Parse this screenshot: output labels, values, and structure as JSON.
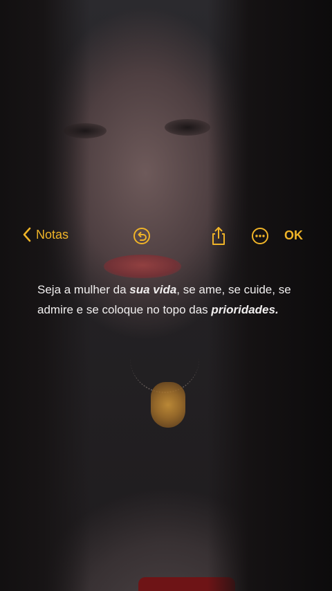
{
  "colors": {
    "accent": "#f0b428",
    "text": "#f1efef"
  },
  "navbar": {
    "back_label": "Notas",
    "back_icon": "chevron-left-icon",
    "undo_icon": "undo-circle-icon",
    "share_icon": "share-icon",
    "more_icon": "ellipsis-circle-icon",
    "done_label": "OK"
  },
  "note": {
    "seg1": "Seja a mulher da ",
    "seg2": "sua vida",
    "seg3": ", se ame, se cuide, se admire e se coloque no topo das ",
    "seg4": "prioridades."
  }
}
